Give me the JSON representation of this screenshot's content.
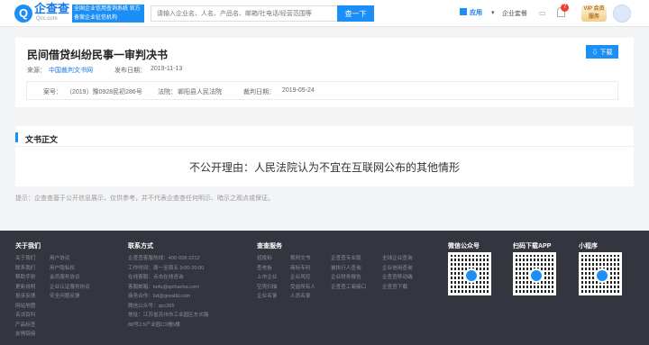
{
  "header": {
    "brand": "企查查",
    "brand_url": "Qcc.com",
    "slogan": "全国企业信用查询系统 官方备案企业征信机构",
    "search_placeholder": "请输入企业名、人名、产品名、邮箱/社电话/经营范围等",
    "search_button": "查一下",
    "app_label": "应用",
    "enterprise_suite": "企业套餐",
    "notification_count": "7",
    "vip_label": "VIP 会员服务"
  },
  "document": {
    "title": "民间借贷纠纷民事一审判决书",
    "download_label": "下载",
    "source_label": "来源：",
    "source_value": "中国裁判文书网",
    "publish_label": "发布日期：",
    "publish_date": "2019-11-13",
    "case_no_label": "案号：",
    "case_no": "（2019）豫0928民初286号",
    "court_label": "法院：",
    "court": "郸阳县人民法院",
    "judge_date_label": "裁判日期：",
    "judge_date": "2019-05-24"
  },
  "text_section": {
    "title": "文书正文",
    "notice": "不公开理由：人民法院认为不宜在互联网公布的其他情形"
  },
  "disclaimer": "提示：企查查基于公开信息展示，仅供参考，并不代表企查查任何明示、暗示之观点或保证。",
  "footer": {
    "about": {
      "title": "关于我们",
      "col1": [
        "关于我们",
        "联系我们",
        "帮助手册",
        "更新说明",
        "投诉反馈",
        "网站地图",
        "名词百科",
        "产品标签",
        "友情链接"
      ],
      "col2": [
        "用户协议",
        "用户隐私权",
        "会员服务协议",
        "企业认证服务协议",
        "安全问题反馈"
      ]
    },
    "contact": {
      "title": "联系方式",
      "lines": [
        "企查查客服热线：400-928-2212",
        "工作时间：周一至周五 9:00-20:00",
        "在线客服：点击在线咨询",
        "客服邮箱：kefu@qichacha.com",
        "商务合作：bd@greatld.com",
        "微信公众号：qcc365",
        "地址：江苏省苏州市工业园区东长路",
        "88号2.5产业园C1幢5楼"
      ]
    },
    "services": {
      "title": "查查服务",
      "col1": [
        "招投标",
        "查老板",
        "上市企业",
        "空壳扫描",
        "企业名录"
      ],
      "col2": [
        "裁判文书",
        "商标专利",
        "企业风控",
        "受益所有人",
        "人员名录"
      ],
      "col3": [
        "企查查专业版",
        "被执行人查询",
        "企业财务报告",
        "企查查工商接口"
      ],
      "col4": [
        "全球企业查询",
        "企业信用查询",
        "企查查移动端",
        "企查查下载"
      ]
    },
    "qr": [
      {
        "title": "微信公众号"
      },
      {
        "title": "扫码下载APP"
      },
      {
        "title": "小程序"
      }
    ]
  }
}
